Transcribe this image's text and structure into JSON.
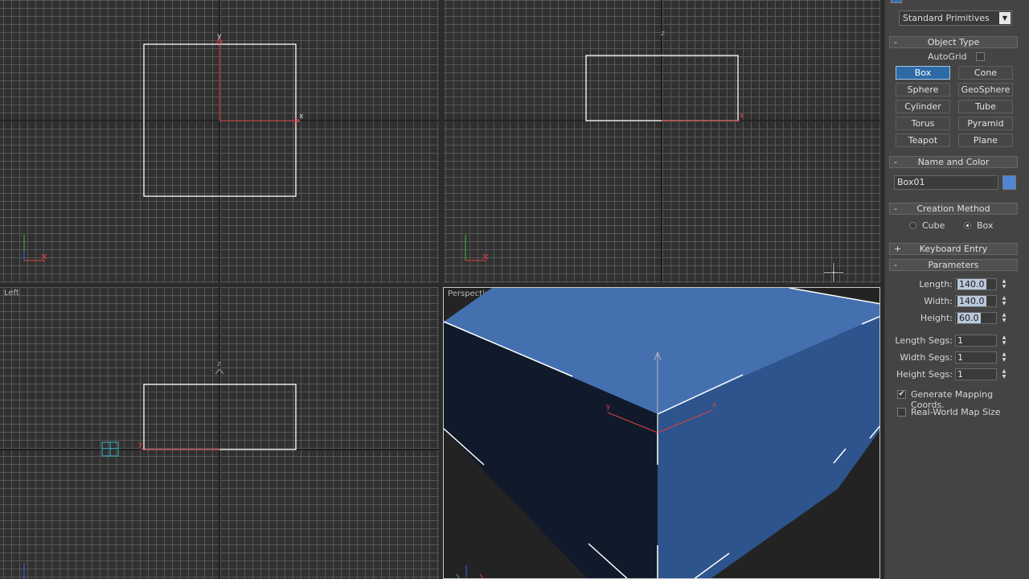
{
  "viewports": {
    "top": {
      "label": ""
    },
    "front": {
      "label": ""
    },
    "left": {
      "label": "Left"
    },
    "perspective": {
      "label": "Perspective"
    }
  },
  "axis_labels": {
    "x": "x",
    "y": "y",
    "z": "z"
  },
  "panel": {
    "category_dropdown": "Standard Primitives",
    "object_type": {
      "header": "Object Type",
      "autogrid_label": "AutoGrid",
      "autogrid_checked": false,
      "buttons": [
        "Box",
        "Cone",
        "Sphere",
        "GeoSphere",
        "Cylinder",
        "Tube",
        "Torus",
        "Pyramid",
        "Teapot",
        "Plane"
      ],
      "active_button": "Box"
    },
    "name_and_color": {
      "header": "Name and Color",
      "name": "Box01",
      "color": "#4f86d6"
    },
    "creation_method": {
      "header": "Creation Method",
      "options": [
        "Cube",
        "Box"
      ],
      "selected": "Box"
    },
    "keyboard_entry": {
      "header": "Keyboard Entry"
    },
    "parameters": {
      "header": "Parameters",
      "length_label": "Length:",
      "length": "140.0",
      "width_label": "Width:",
      "width": "140.0",
      "height_label": "Height:",
      "height": "60.0",
      "length_segs_label": "Length Segs:",
      "length_segs": "1",
      "width_segs_label": "Width Segs:",
      "width_segs": "1",
      "height_segs_label": "Height Segs:",
      "height_segs": "1",
      "gen_mapping_label": "Generate Mapping Coords.",
      "gen_mapping_checked": true,
      "real_world_label": "Real-World Map Size",
      "real_world_checked": false
    }
  },
  "colors": {
    "object": "#4f86d6",
    "selection": "#ffffff",
    "x_axis": "#e04040",
    "y_axis": "#40c040",
    "z_axis": "#4060e0",
    "grid": "#565656",
    "active_button": "#2e6aa6"
  }
}
